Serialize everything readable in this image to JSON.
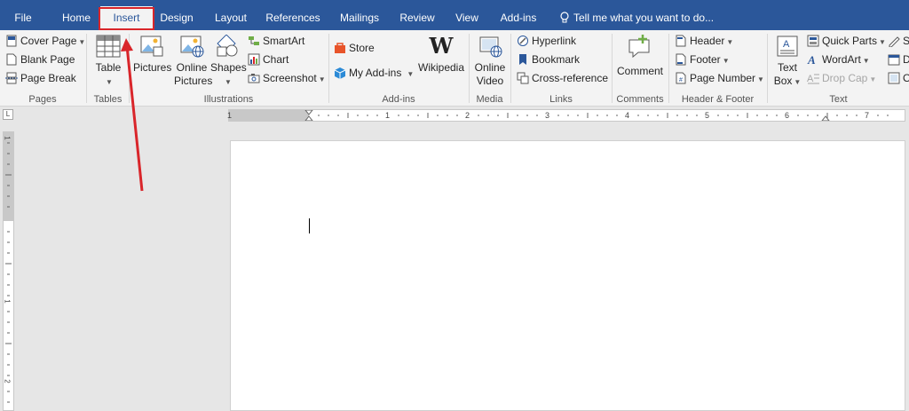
{
  "tabs": {
    "file": "File",
    "home": "Home",
    "insert": "Insert",
    "design": "Design",
    "layout": "Layout",
    "references": "References",
    "mailings": "Mailings",
    "review": "Review",
    "view": "View",
    "addins": "Add-ins",
    "tell_me": "Tell me what you want to do..."
  },
  "ribbon": {
    "pages": {
      "label": "Pages",
      "cover_page": "Cover Page",
      "blank_page": "Blank Page",
      "page_break": "Page Break"
    },
    "tables": {
      "label": "Tables",
      "table": "Table"
    },
    "illustrations": {
      "label": "Illustrations",
      "pictures": "Pictures",
      "online_pictures_1": "Online",
      "online_pictures_2": "Pictures",
      "shapes": "Shapes",
      "smartart": "SmartArt",
      "chart": "Chart",
      "screenshot": "Screenshot"
    },
    "addins": {
      "label": "Add-ins",
      "store": "Store",
      "my_addins": "My Add-ins",
      "wikipedia": "Wikipedia"
    },
    "media": {
      "label": "Media",
      "online_video_1": "Online",
      "online_video_2": "Video"
    },
    "links": {
      "label": "Links",
      "hyperlink": "Hyperlink",
      "bookmark": "Bookmark",
      "cross_reference": "Cross-reference"
    },
    "comments": {
      "label": "Comments",
      "comment": "Comment"
    },
    "header_footer": {
      "label": "Header & Footer",
      "header": "Header",
      "footer": "Footer",
      "page_number": "Page Number"
    },
    "text": {
      "label": "Text",
      "text_box_1": "Text",
      "text_box_2": "Box",
      "quick_parts": "Quick Parts",
      "wordart": "WordArt",
      "drop_cap": "Drop Cap",
      "cut_1": "S",
      "cut_2": "D",
      "cut_3": "O"
    }
  },
  "ruler": {
    "corner": "L",
    "numbers": [
      "1",
      "1",
      "2",
      "3",
      "4",
      "5",
      "6",
      "7"
    ],
    "vnumbers": [
      "1",
      "1",
      "2"
    ]
  },
  "colors": {
    "accent": "#2b579a",
    "highlight": "#d9252a"
  }
}
